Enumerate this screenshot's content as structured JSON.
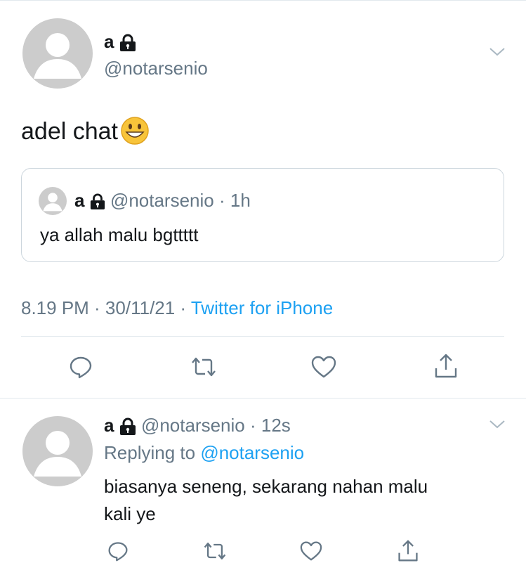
{
  "main_tweet": {
    "display_name": "a",
    "handle": "@notarsenio",
    "text": "adel chat",
    "emoji": "grinning-face-emoji",
    "timestamp": "8.19 PM · 30/11/21 ·",
    "source": "Twitter for iPhone"
  },
  "quoted_tweet": {
    "display_name": "a",
    "handle": "@notarsenio",
    "time": "· 1h",
    "text": "ya allah malu bgttttt"
  },
  "actions": [
    "reply-icon",
    "retweet-icon",
    "like-icon",
    "share-icon"
  ],
  "reply_tweet": {
    "display_name": "a",
    "handle": "@notarsenio",
    "time": "· 12s",
    "replying_prefix": "Replying to",
    "replying_handle": "@notarsenio",
    "text_line1": "biasanya seneng, sekarang nahan malu",
    "text_line2": "kali ye"
  },
  "colors": {
    "accent": "#1da1f2",
    "secondary_text": "#657786",
    "icon": "#657786",
    "avatar": "#cccccc"
  }
}
